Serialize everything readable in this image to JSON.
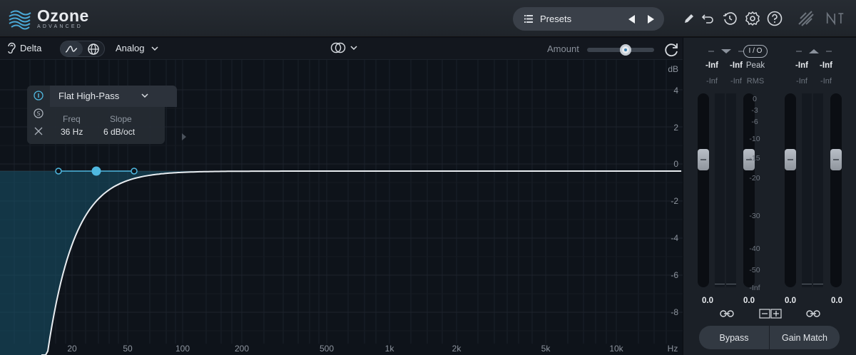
{
  "app": {
    "name": "Ozone",
    "edition": "ADVANCED"
  },
  "toolbar": {
    "presets_label": "Presets",
    "icons": [
      "list-icon",
      "prev-arrow-icon",
      "next-arrow-icon",
      "pencil-icon",
      "undo-icon",
      "history-icon",
      "settings-gear-icon",
      "help-icon",
      "signal-chain-icon",
      "ni-logo-icon"
    ]
  },
  "module": {
    "delta_label": "Delta",
    "mode_label": "Analog",
    "amount_label": "Amount",
    "amount_value": 0.55
  },
  "band": {
    "type": "Flat High-Pass",
    "freq_label": "Freq",
    "freq_value": "36 Hz",
    "slope_label": "Slope",
    "slope_value": "6 dB/oct",
    "side_buttons": [
      "I",
      "S",
      "×"
    ]
  },
  "eq": {
    "db_unit": "dB",
    "db_labels": [
      "4",
      "2",
      "0",
      "-2",
      "-4",
      "-6",
      "-8"
    ],
    "freq_labels": [
      "20",
      "50",
      "100",
      "200",
      "500",
      "1k",
      "2k",
      "5k",
      "10k"
    ],
    "freq_unit": "Hz",
    "accent_color": "#4fb8e0",
    "fill_color": "#17536b"
  },
  "meters": {
    "in_peak_left": "-Inf",
    "in_peak_right": "-Inf",
    "in_rms_left": "-Inf",
    "in_rms_right": "-Inf",
    "out_peak_left": "-Inf",
    "out_peak_right": "-Inf",
    "out_rms_left": "-Inf",
    "out_rms_right": "-Inf",
    "peak_label": "Peak",
    "rms_label": "RMS",
    "io_label": "I / O",
    "scale": [
      "0",
      "-3",
      "-6",
      "-10",
      "-15",
      "-20",
      "-30",
      "-40",
      "-50",
      "-Inf"
    ],
    "in_gain_left": "0.0",
    "in_gain_right": "0.0",
    "out_gain_left": "0.0",
    "out_gain_right": "0.0",
    "bypass_label": "Bypass",
    "gain_match_label": "Gain Match"
  }
}
